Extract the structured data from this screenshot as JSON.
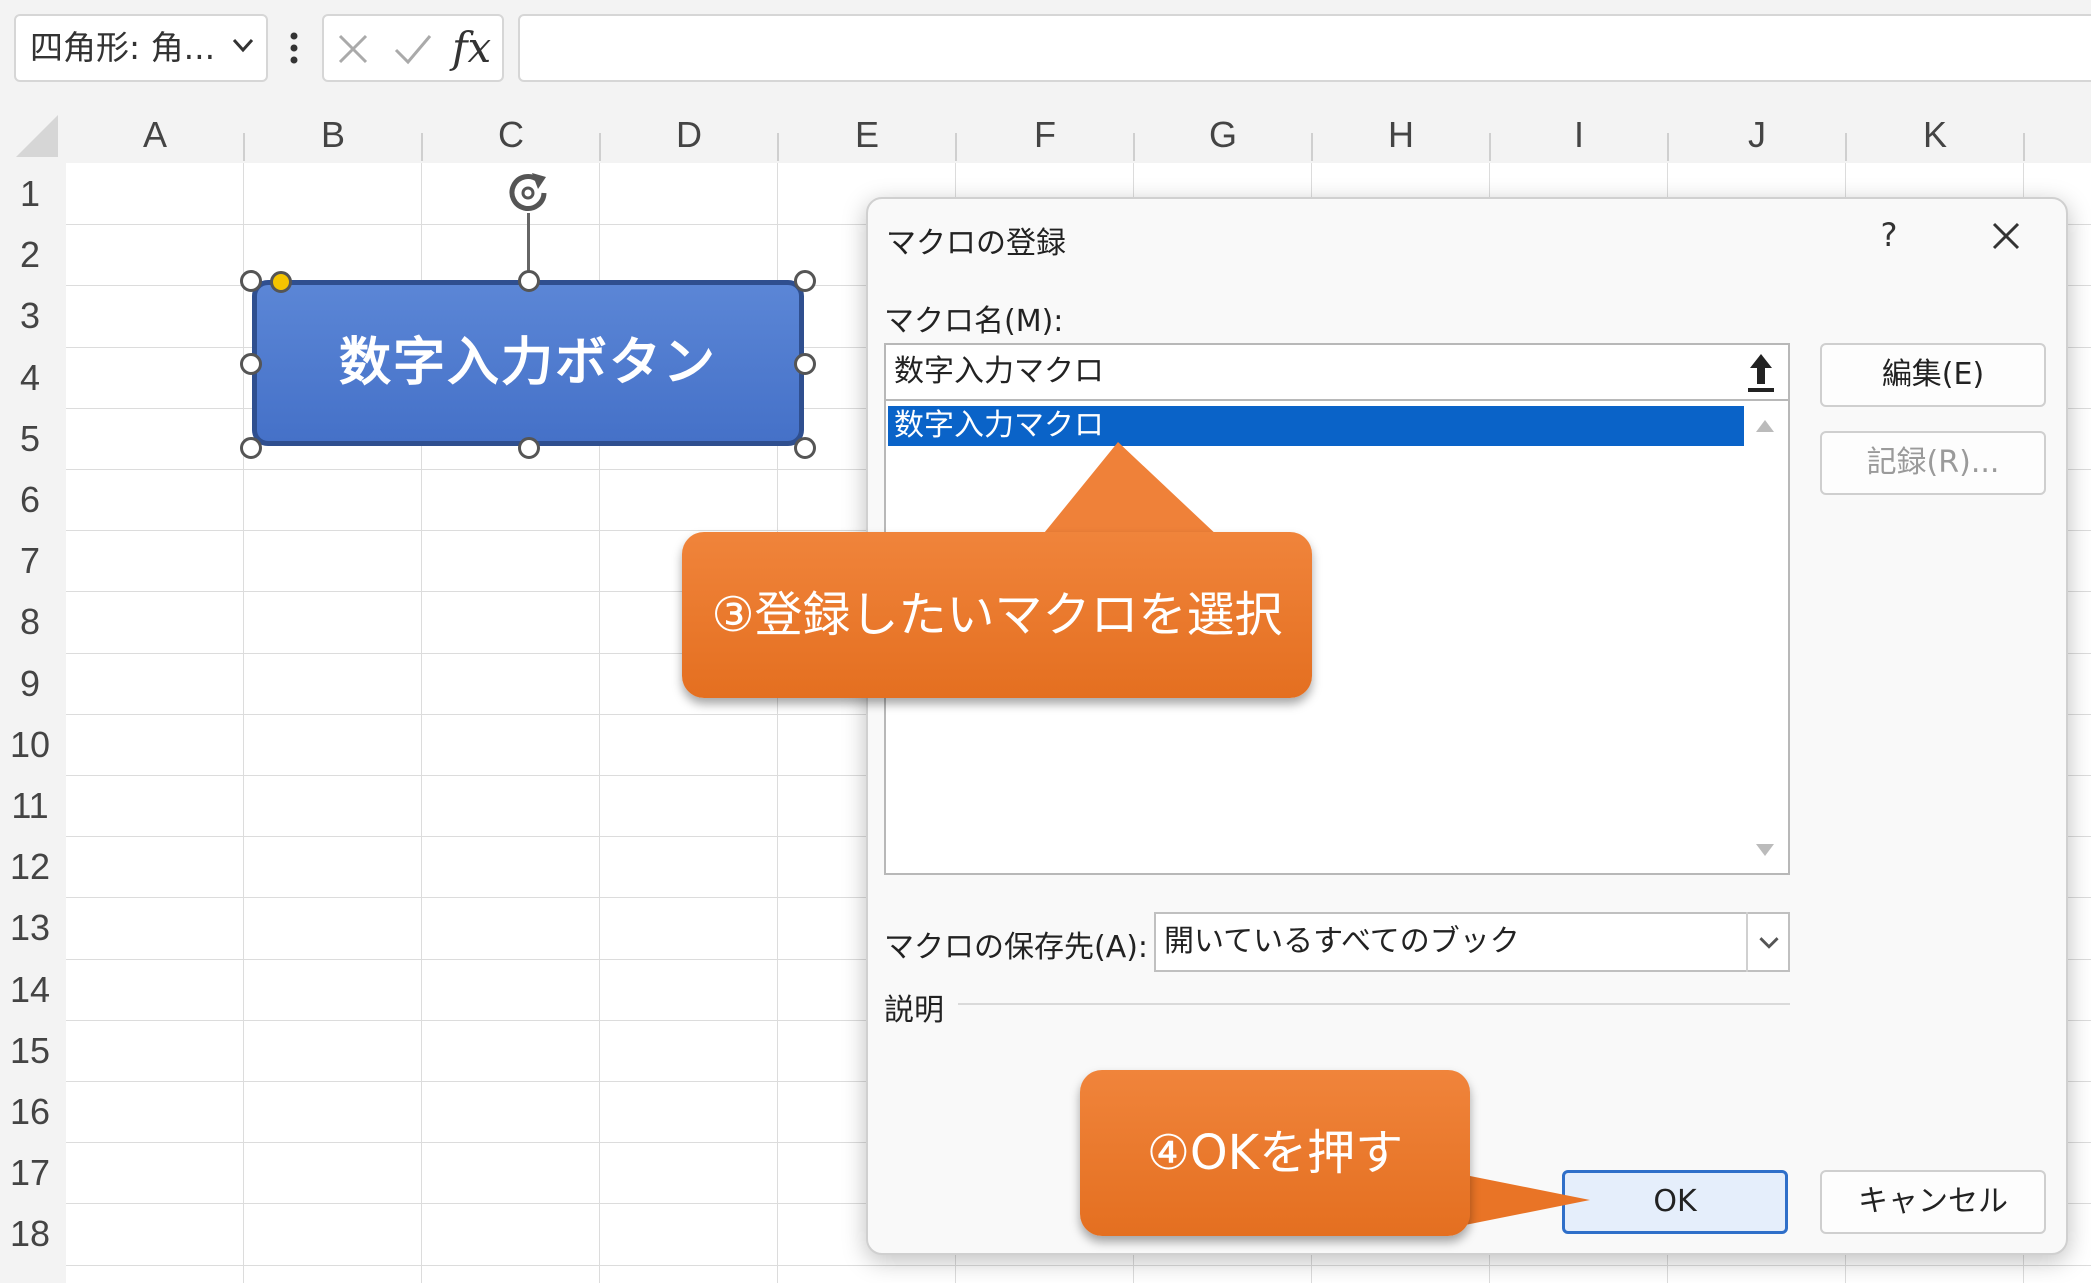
{
  "toolbar": {
    "name_box": "四角形: 角...",
    "fx_label": "fx"
  },
  "columns": [
    "A",
    "B",
    "C",
    "D",
    "E",
    "F",
    "G",
    "H",
    "I",
    "J",
    "K"
  ],
  "rows": [
    "1",
    "2",
    "3",
    "4",
    "5",
    "6",
    "7",
    "8",
    "9",
    "10",
    "11",
    "12",
    "13",
    "14",
    "15",
    "16",
    "17",
    "18"
  ],
  "shape": {
    "text": "数字入力ボタン",
    "fill_color": "#4a78cc"
  },
  "dialog": {
    "title": "マクロの登録",
    "help": "?",
    "macro_name_label": "マクロ名(M):",
    "macro_name_value": "数字入力マクロ",
    "macro_list": [
      "数字入力マクロ"
    ],
    "edit_button": "編集(E)",
    "record_button": "記録(R)...",
    "storage_label": "マクロの保存先(A):",
    "storage_value": "開いているすべてのブック",
    "description_label": "説明",
    "ok_button": "OK",
    "cancel_button": "キャンセル",
    "selection_color": "#0a63c8"
  },
  "callouts": {
    "step3": "③登録したいマクロを選択",
    "step4": "④OKを押す",
    "color": "#e87728"
  }
}
